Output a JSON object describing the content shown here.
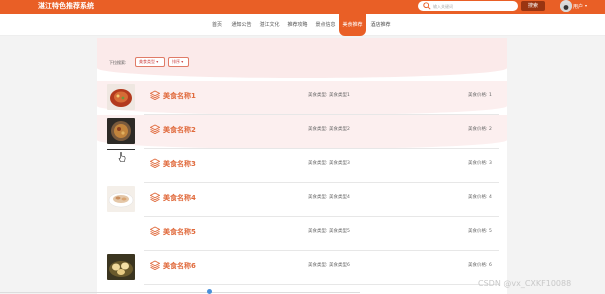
{
  "header": {
    "site_title": "湛江特色推荐系统",
    "search_placeholder": "输入关键词",
    "search_button": "搜索",
    "user_label": "用户",
    "user_caret": "▾"
  },
  "nav": {
    "items": [
      {
        "label": "首页"
      },
      {
        "label": "通知公告"
      },
      {
        "label": "湛江文化"
      },
      {
        "label": "推荐攻略"
      },
      {
        "label": "景点信息"
      },
      {
        "label": "美食推荐"
      },
      {
        "label": "酒店推荐"
      }
    ],
    "active_index": 5
  },
  "filters": {
    "label": "下拉搜索:",
    "type_select": "美食类型 ▾",
    "sort_select": "排序 ▾"
  },
  "items": [
    {
      "name": "美食名称1",
      "type": "美食类型: 美食类型1",
      "price": "美食价格: 1",
      "style": "pink",
      "thumb": "food-bowl-1"
    },
    {
      "name": "美食名称2",
      "type": "美食类型: 美食类型2",
      "price": "美食价格: 2",
      "style": "pink",
      "thumb": "food-bowl-2"
    },
    {
      "name": "美食名称3",
      "type": "美食类型: 美食类型3",
      "price": "美食价格: 3",
      "style": "white",
      "thumb": "none"
    },
    {
      "name": "美食名称4",
      "type": "美食类型: 美食类型4",
      "price": "美食价格: 4",
      "style": "white",
      "thumb": "food-plate"
    },
    {
      "name": "美食名称5",
      "type": "美食类型: 美食类型5",
      "price": "美食价格: 5",
      "style": "white",
      "thumb": "none"
    },
    {
      "name": "美食名称6",
      "type": "美食类型: 美食类型6",
      "price": "美食价格: 6",
      "style": "white",
      "thumb": "food-dumplings"
    }
  ],
  "watermark": "CSDN @vx_CXKF10088",
  "colors": {
    "accent": "#e95f26",
    "accent_dark": "#9a3411",
    "item_title": "#e06a3c",
    "pink_band": "#fcefef"
  }
}
